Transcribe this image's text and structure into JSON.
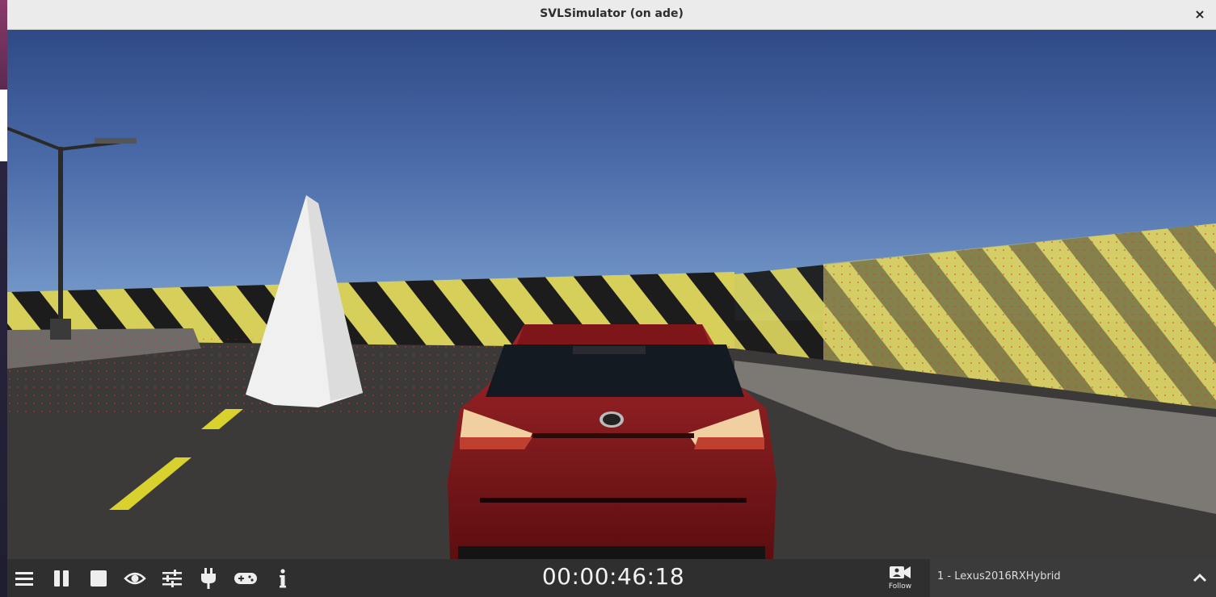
{
  "window": {
    "title": "SVLSimulator (on ade)",
    "close_glyph": "×"
  },
  "scene": {
    "description_icon": "simulation-viewport",
    "colors": {
      "sky_top": "#2f4a86",
      "sky_bottom": "#6e93c4",
      "road": "#3b3a38",
      "barrier_yellow": "#d6cf5a",
      "barrier_black": "#1c1c1c",
      "car_body": "#8a1a1c",
      "lane_yellow": "#d9d12e"
    }
  },
  "toolbar": {
    "buttons": [
      {
        "name": "menu",
        "icon": "hamburger-icon"
      },
      {
        "name": "pause",
        "icon": "pause-icon"
      },
      {
        "name": "stop",
        "icon": "stop-icon"
      },
      {
        "name": "visibility",
        "icon": "eye-icon"
      },
      {
        "name": "settings",
        "icon": "sliders-icon"
      },
      {
        "name": "bridge",
        "icon": "plug-icon"
      },
      {
        "name": "controls",
        "icon": "gamepad-icon"
      },
      {
        "name": "info",
        "icon": "info-icon"
      }
    ],
    "clock": "00:00:46:18",
    "follow_label": "Follow",
    "vehicle_selected": "1 - Lexus2016RXHybrid",
    "expand_icon": "chevron-up-icon"
  }
}
